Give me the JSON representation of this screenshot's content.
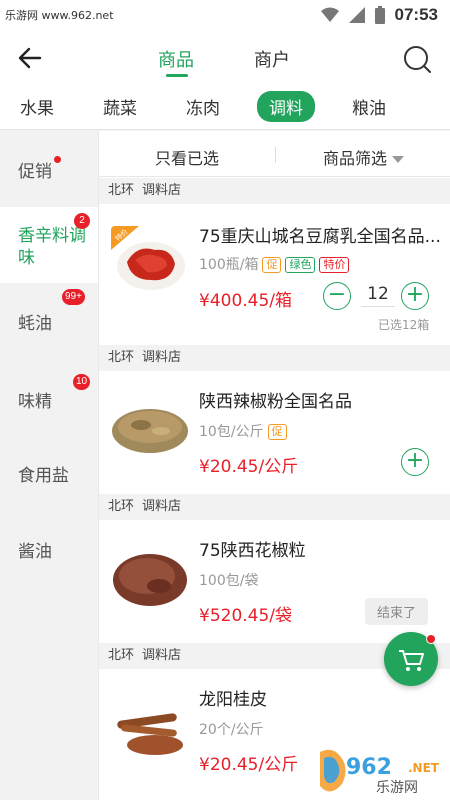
{
  "status_bar": {
    "site": "乐游网 www.962.net",
    "time": "07:53"
  },
  "header": {
    "tabs": [
      {
        "label": "商品",
        "active": true
      },
      {
        "label": "商户",
        "active": false
      }
    ]
  },
  "categories": [
    {
      "label": "水果",
      "active": false
    },
    {
      "label": "蔬菜",
      "active": false
    },
    {
      "label": "冻肉",
      "active": false
    },
    {
      "label": "调料",
      "active": true
    },
    {
      "label": "粮油",
      "active": false
    }
  ],
  "sidebar": {
    "items": [
      {
        "label": "促销",
        "badge": "",
        "dot": true
      },
      {
        "label": "香辛料调味",
        "badge": "2",
        "dot": false,
        "active": true
      },
      {
        "label": "蚝油",
        "badge": "99+",
        "dot": false
      },
      {
        "label": "味精",
        "badge": "10",
        "dot": false
      },
      {
        "label": "食用盐",
        "badge": "",
        "dot": false
      },
      {
        "label": "酱油",
        "badge": "",
        "dot": false
      }
    ]
  },
  "filter": {
    "only_selected": "只看已选",
    "product_filter": "商品筛选"
  },
  "products": [
    {
      "shop_area": "北环",
      "shop_name": "调料店",
      "name": "75重庆山城名豆腐乳全国名品...",
      "unit": "100瓶/箱",
      "tags": [
        "促",
        "绿色",
        "特价"
      ],
      "corner_label": "特价",
      "price": "¥400.45/箱",
      "quantity": "12",
      "selected_note": "已选12箱"
    },
    {
      "shop_area": "北环",
      "shop_name": "调料店",
      "name": "陕西辣椒粉全国名品",
      "unit": "10包/公斤",
      "tags": [
        "促"
      ],
      "price": "¥20.45/公斤"
    },
    {
      "shop_area": "北环",
      "shop_name": "调料店",
      "name": "75陕西花椒粒",
      "unit": "100包/袋",
      "tags": [],
      "price": "¥520.45/袋",
      "action": "结束了"
    },
    {
      "shop_area": "北环",
      "shop_name": "调料店",
      "name": "龙阳桂皮",
      "unit": "20个/公斤",
      "tags": [],
      "price": "¥20.45/公斤"
    }
  ],
  "watermark": {
    "brand_number": "962",
    "brand_net": ".NET",
    "brand_cn": "乐游网"
  },
  "colors": {
    "accent": "#22a45d",
    "price": "#e8202a",
    "promo": "#f59a23"
  }
}
